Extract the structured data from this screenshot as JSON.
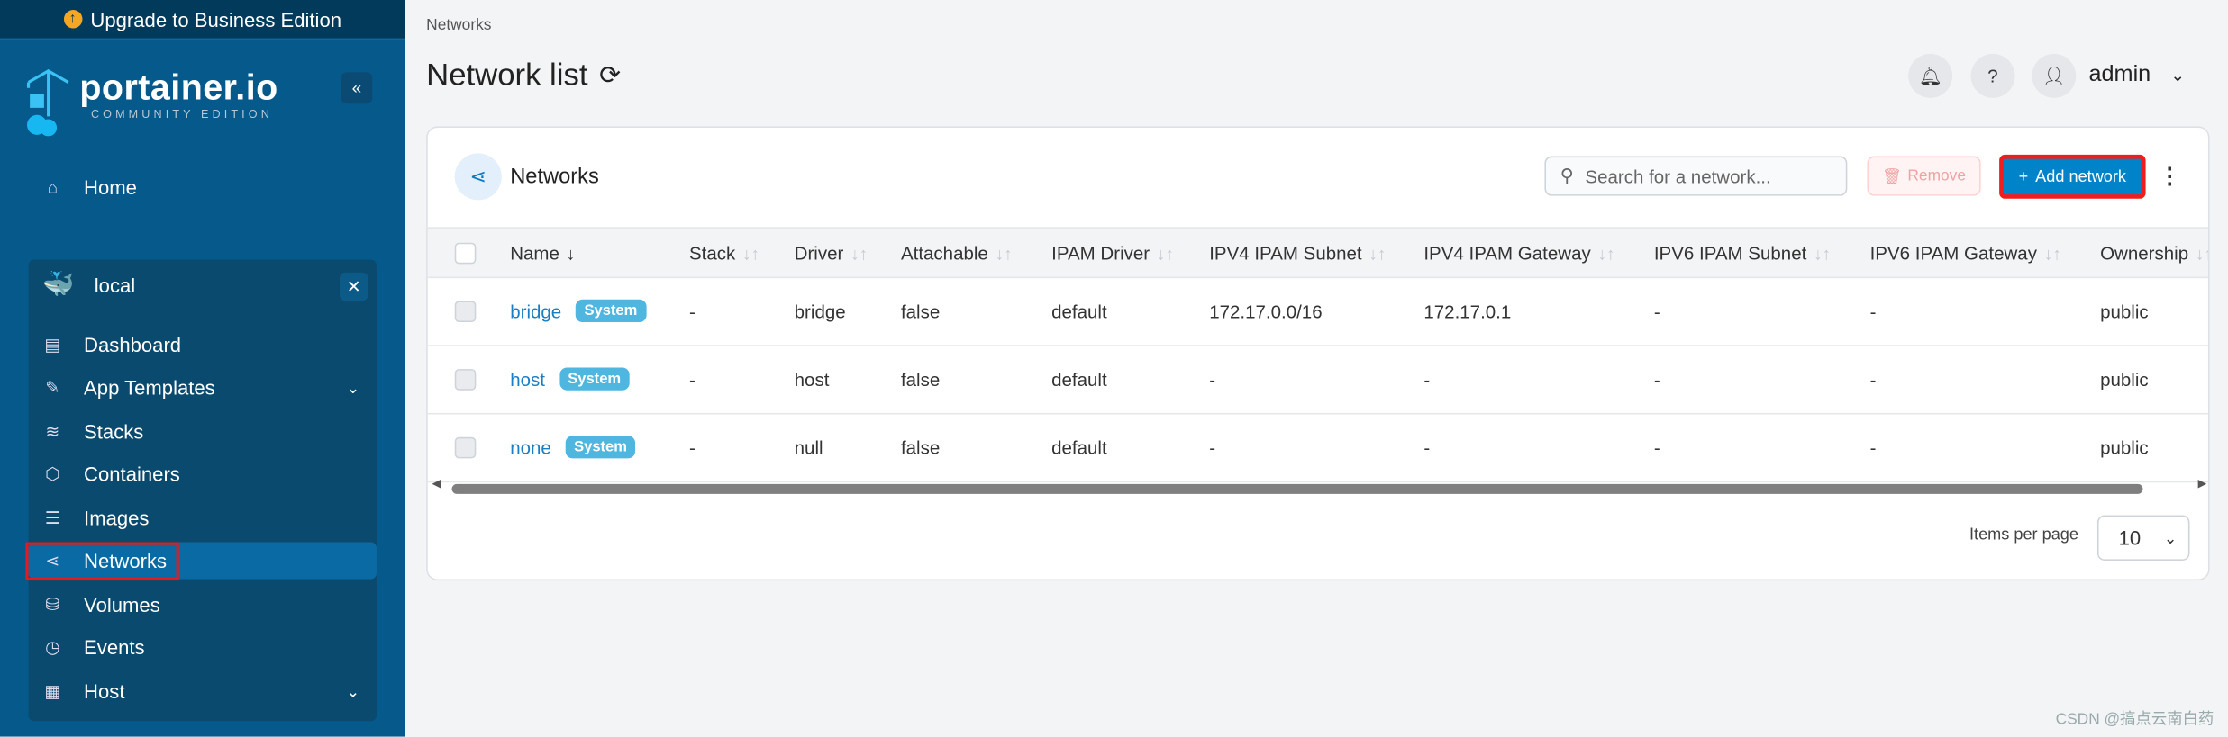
{
  "sidebar": {
    "upgrade": "Upgrade to Business Edition",
    "logo_text": "portainer.io",
    "logo_sub": "COMMUNITY EDITION",
    "home": "Home",
    "env": "local",
    "items": [
      {
        "label": "Dashboard",
        "icon": "dashboard-icon"
      },
      {
        "label": "App Templates",
        "icon": "edit-icon"
      },
      {
        "label": "Stacks",
        "icon": "layers-icon"
      },
      {
        "label": "Containers",
        "icon": "box-icon"
      },
      {
        "label": "Images",
        "icon": "list-icon"
      },
      {
        "label": "Networks",
        "icon": "share-icon"
      },
      {
        "label": "Volumes",
        "icon": "database-icon"
      },
      {
        "label": "Events",
        "icon": "clock-icon"
      },
      {
        "label": "Host",
        "icon": "host-icon"
      }
    ]
  },
  "header": {
    "breadcrumb": "Networks",
    "title": "Network list",
    "user": "admin"
  },
  "card": {
    "title": "Networks",
    "search_placeholder": "Search for a network...",
    "remove": "Remove",
    "add": "Add network",
    "columns": [
      "Name",
      "Stack",
      "Driver",
      "Attachable",
      "IPAM Driver",
      "IPV4 IPAM Subnet",
      "IPV4 IPAM Gateway",
      "IPV6 IPAM Subnet",
      "IPV6 IPAM Gateway",
      "Ownership"
    ],
    "rows": [
      [
        "bridge",
        "-",
        "bridge",
        "false",
        "default",
        "172.17.0.0/16",
        "172.17.0.1",
        "-",
        "-",
        "public"
      ],
      [
        "host",
        "-",
        "host",
        "false",
        "default",
        "-",
        "-",
        "-",
        "-",
        "public"
      ],
      [
        "none",
        "-",
        "null",
        "false",
        "default",
        "-",
        "-",
        "-",
        "-",
        "public"
      ]
    ],
    "badge": "System",
    "items_per_page_label": "Items per page",
    "items_per_page": "10"
  },
  "colors": {
    "sidebar": "#05598b",
    "accent": "#0083c9",
    "badge": "#4fb6e0"
  },
  "watermark": "CSDN @搞点云南白药"
}
